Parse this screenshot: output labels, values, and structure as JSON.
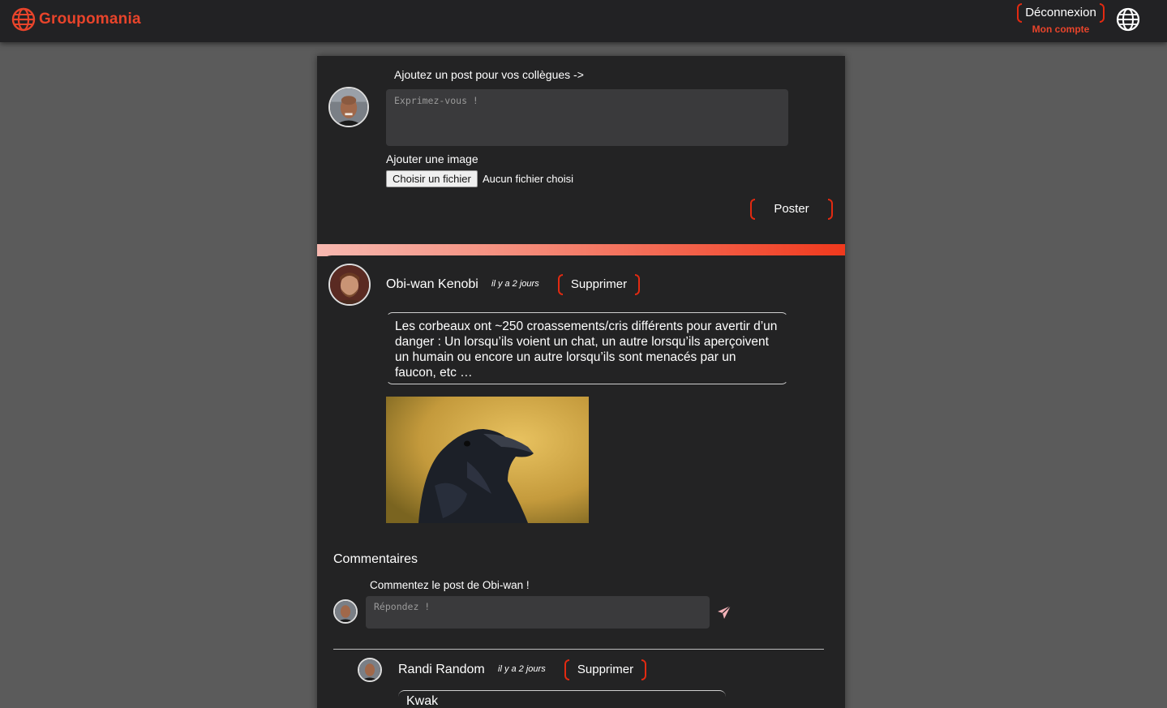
{
  "header": {
    "brand": "Groupomania",
    "logout_label": "Déconnexion",
    "account_label": "Mon compte"
  },
  "composer": {
    "title": "Ajoutez un post pour vos collègues ->",
    "placeholder": "Exprimez-vous !",
    "image_label": "Ajouter une image",
    "file_button": "Choisir un fichier",
    "file_status": "Aucun fichier choisi",
    "submit_label": "Poster"
  },
  "post": {
    "author": "Obi-wan Kenobi",
    "time": "il y a 2 jours",
    "delete_label": "Supprimer",
    "text": "Les corbeaux ont ~250 croassements/cris différents pour avertir d’un danger : Un lorsqu’ils voient un chat, un autre lorsqu’ils aperçoivent un humain ou encore un autre lorsqu’ils sont menacés par un faucon, etc …",
    "comments_title": "Commentaires",
    "comment_prompt": "Commentez le post de Obi-wan !",
    "comment_placeholder": "Répondez !"
  },
  "reply": {
    "author": "Randi Random",
    "time": "il y a 2 jours",
    "delete_label": "Supprimer",
    "text": "Kwak"
  },
  "colors": {
    "accent": "#e8442b",
    "bracket": "#e22a11",
    "panel": "#232324",
    "background": "#5b5b5b"
  },
  "icons": {
    "logo": "globe-icon",
    "account": "globe-icon",
    "send": "paper-plane-icon"
  }
}
